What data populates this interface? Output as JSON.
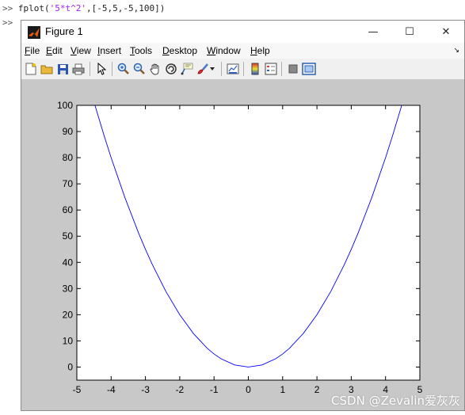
{
  "command_window": {
    "prompt": ">>",
    "cmd_func": "fplot(",
    "cmd_arg": "'5*t^2'",
    "cmd_rest": ",[-5,5,-5,100])"
  },
  "window": {
    "title": "Figure 1",
    "min_symbol": "—",
    "max_symbol": "☐",
    "close_symbol": "✕"
  },
  "menu": [
    {
      "key": "F",
      "rest": "ile"
    },
    {
      "key": "E",
      "rest": "dit"
    },
    {
      "key": "V",
      "rest": "iew"
    },
    {
      "key": "I",
      "rest": "nsert"
    },
    {
      "key": "T",
      "rest": "ools"
    },
    {
      "key": "D",
      "rest": "esktop"
    },
    {
      "key": "W",
      "rest": "indow"
    },
    {
      "key": "H",
      "rest": "elp"
    }
  ],
  "toolbar_icons": [
    "new-figure-icon",
    "open-file-icon",
    "save-icon",
    "print-icon",
    "pointer-icon",
    "zoom-in-icon",
    "zoom-out-icon",
    "pan-hand-icon",
    "rotate-3d-icon",
    "data-cursor-icon",
    "brush-icon",
    "link-plot-icon",
    "colorbar-icon",
    "legend-icon",
    "hide-plot-tools-icon",
    "show-plot-tools-icon"
  ],
  "chart_data": {
    "type": "line",
    "function": "5*t^2",
    "xlim": [
      -5,
      5
    ],
    "ylim": [
      -5,
      100
    ],
    "x_ticks": [
      -5,
      -4,
      -3,
      -2,
      -1,
      0,
      1,
      2,
      3,
      4,
      5
    ],
    "y_ticks": [
      0,
      10,
      20,
      30,
      40,
      50,
      60,
      70,
      80,
      90,
      100
    ],
    "series": [
      {
        "color": "#0000ff",
        "x": [
          -4.5,
          -4.2,
          -4,
          -3.6,
          -3.2,
          -3,
          -2.8,
          -2.4,
          -2,
          -1.6,
          -1.2,
          -1,
          -0.8,
          -0.4,
          0,
          0.4,
          0.8,
          1,
          1.2,
          1.6,
          2,
          2.4,
          2.8,
          3,
          3.2,
          3.6,
          4,
          4.2,
          4.5
        ],
        "y": [
          101.25,
          88.2,
          80,
          64.8,
          51.2,
          45,
          39.2,
          28.8,
          20,
          12.8,
          7.2,
          5,
          3.2,
          0.8,
          0,
          0.8,
          3.2,
          5,
          7.2,
          12.8,
          20,
          28.8,
          39.2,
          45,
          51.2,
          64.8,
          80,
          88.2,
          101.25
        ]
      }
    ],
    "grid": false
  },
  "watermark": "CSDN @Zevalin爱灰灰"
}
